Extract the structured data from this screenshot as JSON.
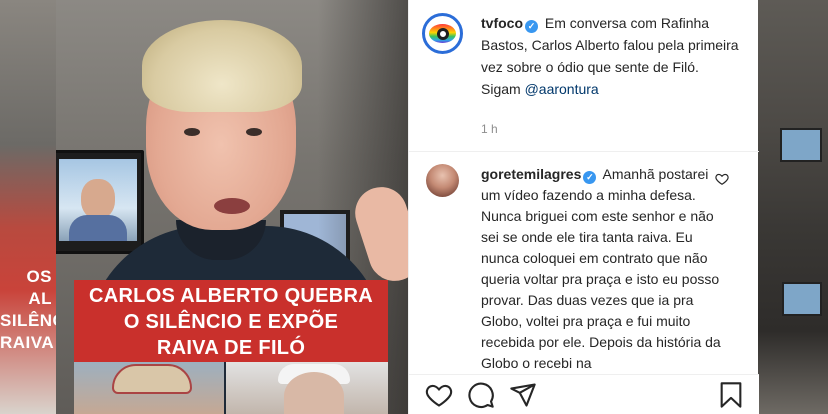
{
  "video": {
    "headline": [
      "CARLOS ALBERTO QUEBRA",
      "O SILÊNCIO E EXPÕE",
      "RAIVA DE FILÓ"
    ],
    "background_left_text": [
      "OS AL",
      "SILÊNC",
      "RAIVA"
    ]
  },
  "post": {
    "username": "tvfoco",
    "verified": true,
    "caption": "Em conversa com Rafinha Bastos, Carlos Alberto falou pela primeira vez sobre o ódio que sente de Filó.",
    "caption_line2_prefix": "Sigam ",
    "caption_mention": "@aarontura",
    "time": "1 h"
  },
  "comment": {
    "username": "goretemilagres",
    "verified": true,
    "text": "Amanhã postarei um vídeo fazendo a minha defesa. Nunca briguei com este senhor e não sei se onde ele tira tanta raiva. Eu nunca coloquei em contrato que não queria voltar pra praça e isto eu posso provar. Das duas vezes que ia pra Globo, voltei pra praça e fui muito recebida por ele. Depois da história da Globo o recebi na"
  },
  "actions": {
    "like": "heart-icon",
    "comment": "comment-icon",
    "share": "share-icon",
    "save": "bookmark-icon"
  },
  "colors": {
    "verified_blue": "#3897f0",
    "headline_red": "#c9302c",
    "mention": "#00376b",
    "meta_gray": "#8e8e8e"
  }
}
